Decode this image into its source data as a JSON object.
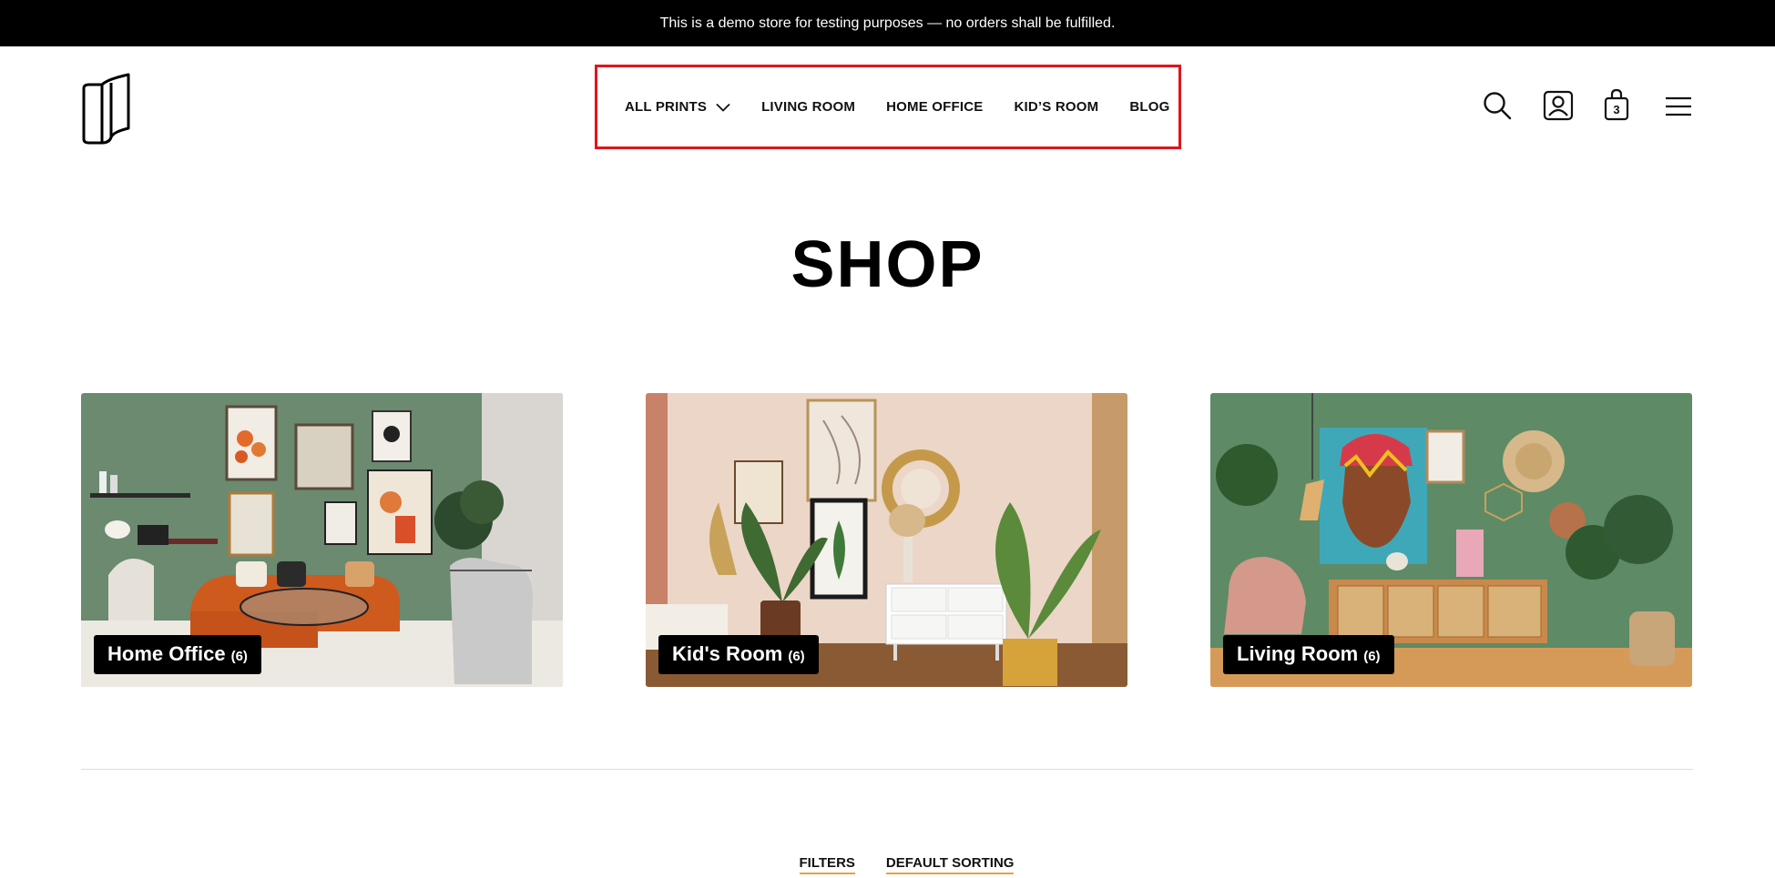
{
  "announcement": "This is a demo store for testing purposes — no orders shall be fulfilled.",
  "nav": {
    "items": [
      {
        "label": "ALL PRINTS",
        "has_dropdown": true
      },
      {
        "label": "LIVING ROOM"
      },
      {
        "label": "HOME OFFICE"
      },
      {
        "label": "KID’S ROOM"
      },
      {
        "label": "BLOG"
      }
    ]
  },
  "header_icons": {
    "search": "search-icon",
    "account": "account-icon",
    "cart": "cart-icon",
    "cart_count": "3",
    "menu": "hamburger-menu-icon"
  },
  "page_title": "SHOP",
  "categories": [
    {
      "name": "Home Office",
      "count": "(6)"
    },
    {
      "name": "Kid's Room",
      "count": "(6)"
    },
    {
      "name": "Living Room",
      "count": "(6)"
    }
  ],
  "controls": {
    "filters": "FILTERS",
    "sorting": "DEFAULT SORTING"
  },
  "colors": {
    "topbar_bg": "#000000",
    "nav_highlight": "#e0151b",
    "control_underline": "#e8a04a"
  }
}
